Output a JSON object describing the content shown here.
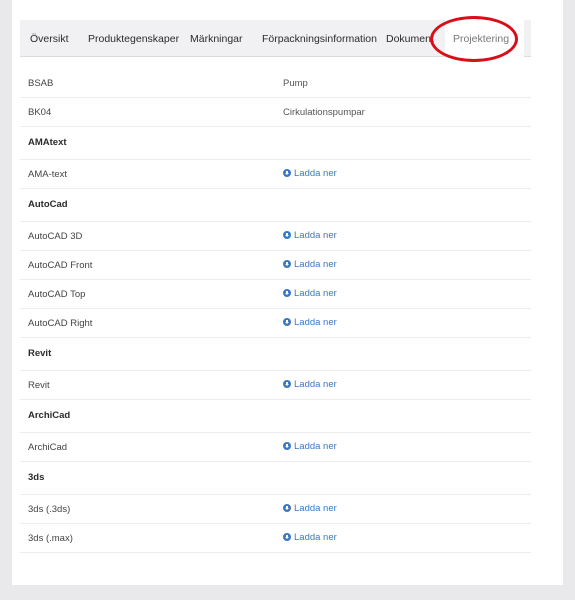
{
  "tabs": [
    {
      "label": "Översikt"
    },
    {
      "label": "Produktegenskaper"
    },
    {
      "label": "Märkningar"
    },
    {
      "label": "Förpackningsinformation"
    },
    {
      "label": "Dokument"
    },
    {
      "label": "Projektering",
      "active": true
    }
  ],
  "rows": {
    "bsab": {
      "label": "BSAB",
      "value": "Pump"
    },
    "bk04": {
      "label": "BK04",
      "value": "Cirkulationspumpar"
    },
    "amatext_heading": "AMAtext",
    "ama_text": {
      "label": "AMA-text",
      "link": "Ladda ner"
    },
    "autocad_heading": "AutoCad",
    "autocad_3d": {
      "label": "AutoCAD 3D",
      "link": "Ladda ner"
    },
    "autocad_front": {
      "label": "AutoCAD Front",
      "link": "Ladda ner"
    },
    "autocad_top": {
      "label": "AutoCAD Top",
      "link": "Ladda ner"
    },
    "autocad_right": {
      "label": "AutoCAD Right",
      "link": "Ladda ner"
    },
    "revit_heading": "Revit",
    "revit": {
      "label": "Revit",
      "link": "Ladda ner"
    },
    "archicad_heading": "ArchiCad",
    "archicad": {
      "label": "ArchiCad",
      "link": "Ladda ner"
    },
    "3ds_heading": "3ds",
    "3ds_3ds": {
      "label": "3ds (.3ds)",
      "link": "Ladda ner"
    },
    "3ds_max": {
      "label": "3ds (.max)",
      "link": "Ladda ner"
    }
  },
  "colors": {
    "link": "#3a78c2",
    "annotation": "#d80f18",
    "background": "#e9e9ec",
    "tab_bar": "#f1f1f3"
  },
  "icons": {
    "download": "download-circle-icon"
  }
}
